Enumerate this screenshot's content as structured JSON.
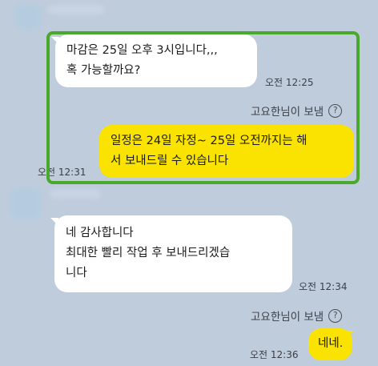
{
  "messages": {
    "m1": {
      "lines": [
        "마감은 25일 오후 3시입니다,,,",
        "혹 가능할까요?"
      ],
      "time": "오전 12:25"
    },
    "m2_sender": {
      "text": "고요한님이 보냄"
    },
    "m2": {
      "lines": [
        "일정은 24일 자정~ 25일 오전까지는 해",
        "서 보내드릴 수 있습니다"
      ],
      "time": "오전 12:31"
    },
    "m3": {
      "lines": [
        "네 감사합니다",
        "최대한 빨리 작업 후 보내드리겠습",
        "니다"
      ],
      "time": "오전 12:34"
    },
    "m4_sender": {
      "text": "고요한님이 보냄"
    },
    "m4": {
      "lines": [
        "네네."
      ],
      "time": "오전 12:36"
    }
  },
  "icons": {
    "help": "?"
  },
  "colors": {
    "background": "#bfccdc",
    "my_bubble": "#fae300",
    "their_bubble": "#ffffff",
    "highlight": "#4aa82c"
  }
}
